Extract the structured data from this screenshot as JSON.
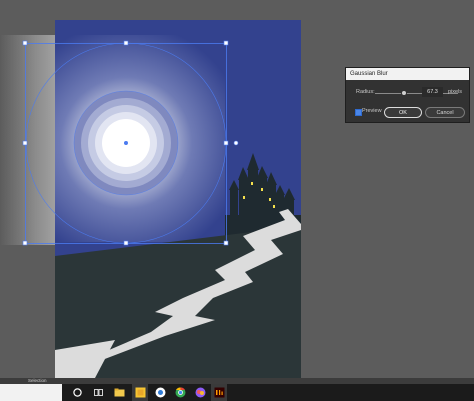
{
  "dialog": {
    "title": "Gaussian Blur",
    "radius_label": "Radius:",
    "radius_value": "67.3",
    "radius_unit": "pixels",
    "preview_label": "Preview",
    "ok_label": "OK",
    "cancel_label": "Cancel"
  },
  "status_bar": {
    "tool": "Selection"
  },
  "colors": {
    "sky": "#33428e",
    "ground": "#2b3638",
    "path": "#dcdcdc",
    "window_light": "#f4e04d"
  },
  "icons": [
    "cortana-icon",
    "task-view-icon",
    "file-explorer-icon",
    "sticky-notes-icon",
    "chrome-icon",
    "edge-icon",
    "photos-icon",
    "illustrator-icon"
  ]
}
